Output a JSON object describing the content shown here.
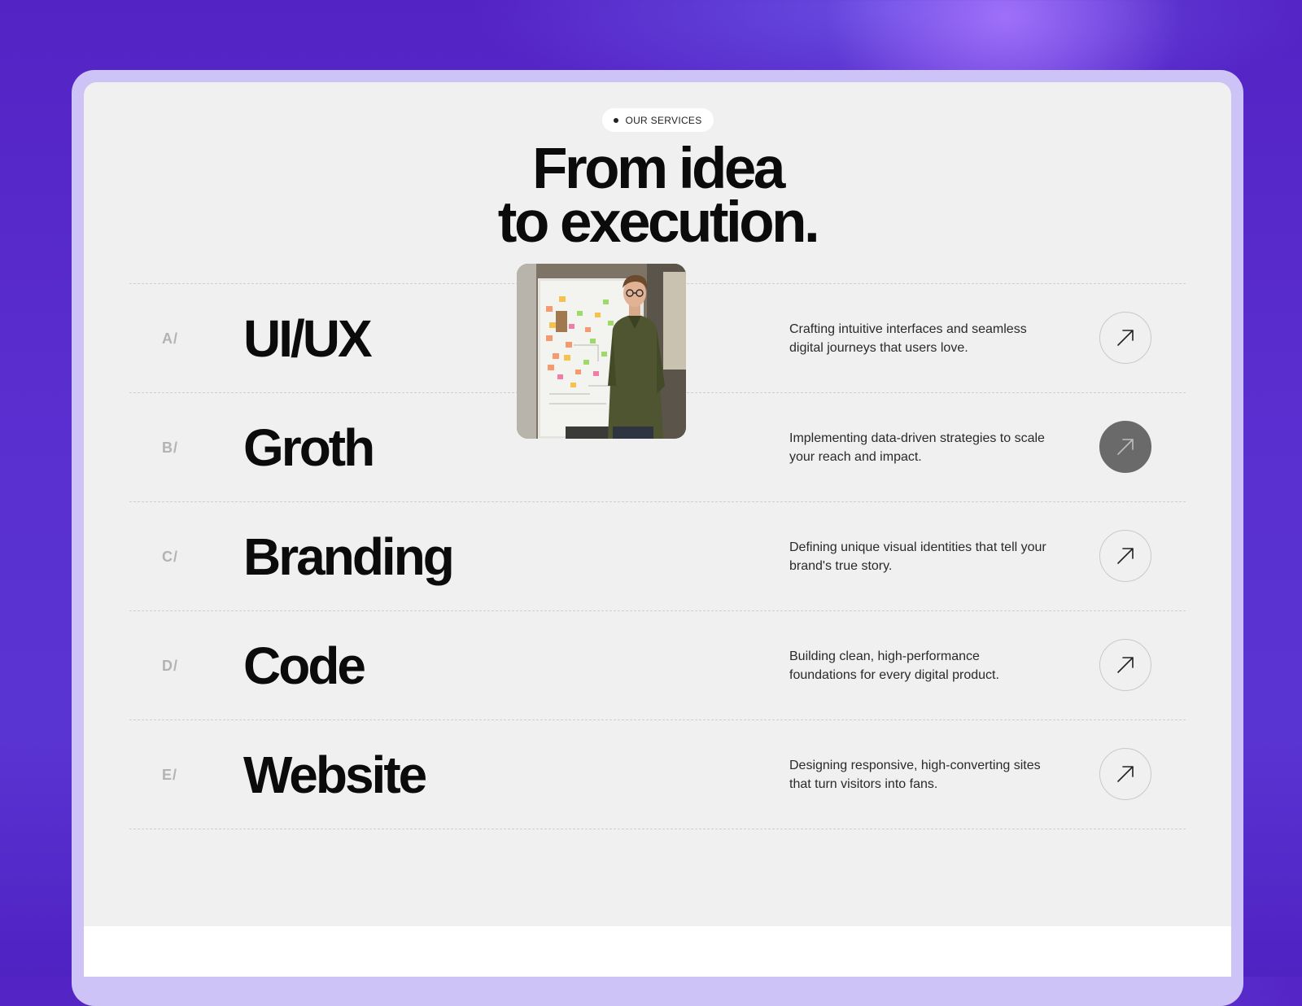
{
  "badge": {
    "label": "OUR SERVICES"
  },
  "headline": {
    "line1": "From idea",
    "line2": "to execution."
  },
  "services": [
    {
      "letter": "A/",
      "title": "UI/UX",
      "description": "Crafting intuitive interfaces and seamless digital journeys that users love.",
      "active": false
    },
    {
      "letter": "B/",
      "title": "Groth",
      "description": "Implementing data-driven strategies to scale your reach and impact.",
      "active": true
    },
    {
      "letter": "C/",
      "title": "Branding",
      "description": "Defining unique visual identities that tell your brand's true story.",
      "active": false
    },
    {
      "letter": "D/",
      "title": "Code",
      "description": "Building clean, high-performance foundations for every digital product.",
      "active": false
    },
    {
      "letter": "E/",
      "title": "Website",
      "description": "Designing responsive, high-converting sites that turn visitors into fans.",
      "active": false
    }
  ],
  "icons": {
    "row_button": "arrow-up-right-icon",
    "badge_dot": "dot-icon"
  },
  "colors": {
    "background": "#5a2fd0",
    "frame": "#cdc3f6",
    "card": "#f0f0f0",
    "active_button": "#6a6a6a",
    "text": "#0b0b0b"
  }
}
